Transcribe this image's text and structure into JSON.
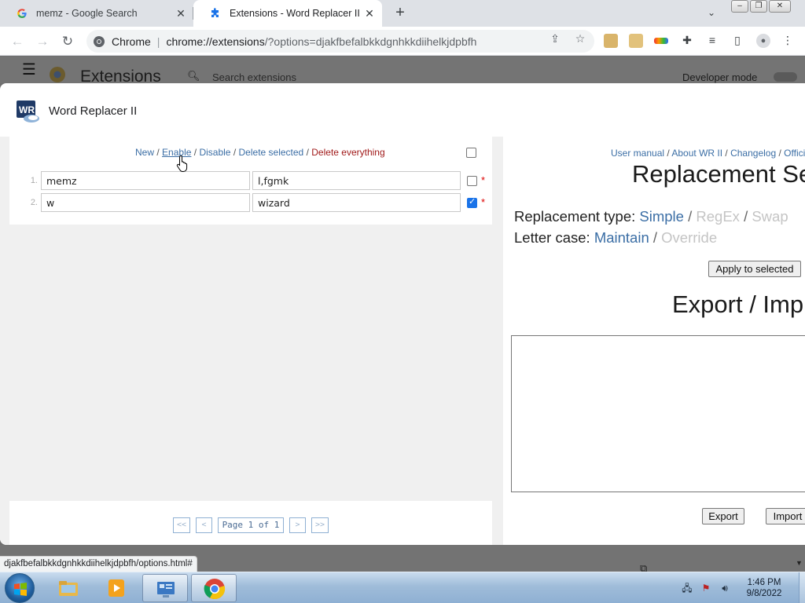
{
  "browser": {
    "tabs": [
      {
        "title": "memz - Google Search",
        "favicon": "google-g-icon",
        "active": false
      },
      {
        "title": "Extensions - Word Replacer II",
        "favicon": "puzzle-piece-icon",
        "active": true
      }
    ],
    "omnibox": {
      "chip": "Chrome",
      "separator": "|",
      "url_host": "chrome://extensions",
      "url_rest": "/?options=djakfbefalbkkdgnhkkdiihelkjdpbfh"
    },
    "colors": {
      "accent": "#1a73e8",
      "tab_strip": "#dee1e6"
    }
  },
  "extensions_page": {
    "title": "Extensions",
    "search_placeholder": "Search extensions",
    "developer_mode_label": "Developer mode"
  },
  "dialog": {
    "title": "Word Replacer II",
    "icon": "wr-logo-icon",
    "list_actions": {
      "new": "New",
      "sep1": "/",
      "enable": "Enable",
      "sep2": "/",
      "disable": "Disable",
      "sep3": "/",
      "delete_selected": "Delete selected",
      "sep4": "/",
      "delete_everything": "Delete everything"
    },
    "rows": [
      {
        "index": "1.",
        "find": "memz",
        "replace": "l,fgmk",
        "checked": false,
        "marker": "*"
      },
      {
        "index": "2.",
        "find": "w",
        "replace": "wizard",
        "checked": true,
        "marker": "*"
      }
    ],
    "pager": {
      "first": "<<",
      "prev": "<",
      "info": "Page 1 of 1",
      "next": ">",
      "last": ">>"
    },
    "top_links": {
      "manual": "User manual",
      "sep1": " / ",
      "about": "About WR II",
      "sep2": " / ",
      "changelog": "Changelog",
      "sep3": " / ",
      "official": "Offici"
    },
    "replacement_heading": "Replacement Se",
    "replacement_type": {
      "label": "Replacement type:",
      "simple": "Simple",
      "sep1": "/",
      "regex": "RegEx",
      "sep2": "/",
      "swap": "Swap"
    },
    "letter_case": {
      "label": "Letter case:",
      "maintain": "Maintain",
      "sep": "/",
      "override": "Override"
    },
    "apply_button": "Apply to selected",
    "export_import_heading": "Export / Imp",
    "export_button": "Export",
    "import_button": "Import"
  },
  "status_bar": {
    "text": "djakfbefalbkkdgnhkkdiihelkjdpbfh/options.html#"
  },
  "taskbar": {
    "pinned": [
      "explorer-folder-icon",
      "media-player-icon",
      "control-panel-icon",
      "chrome-icon"
    ],
    "clock": {
      "time": "1:46 PM",
      "date": "9/8/2022"
    }
  }
}
